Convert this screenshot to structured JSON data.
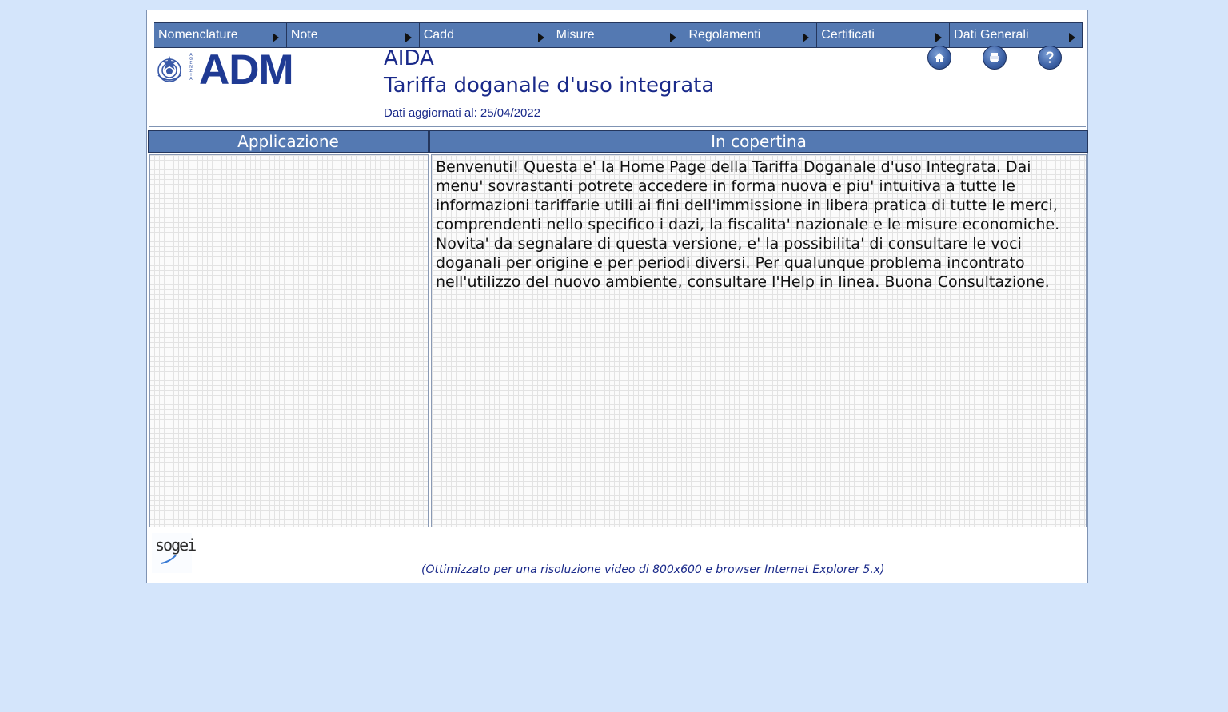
{
  "menu": {
    "items": [
      {
        "label": "Nomenclature"
      },
      {
        "label": "Note"
      },
      {
        "label": "Cadd"
      },
      {
        "label": "Misure"
      },
      {
        "label": "Regolamenti"
      },
      {
        "label": "Certificati"
      },
      {
        "label": "Dati Generali"
      }
    ]
  },
  "header": {
    "logo_text": "ADM",
    "logo_small_text": "AGENZIA",
    "app_name": "AIDA",
    "app_title": "Tariffa doganale d'uso integrata",
    "update_label": "Dati aggiornati al: 25/04/2022",
    "icons": [
      "home-icon",
      "print-icon",
      "help-icon"
    ]
  },
  "sections": {
    "left_title": "Applicazione",
    "right_title": "In copertina"
  },
  "content": {
    "welcome": "Benvenuti! Questa e' la Home Page della Tariffa Doganale d'uso Integrata. Dai menu' sovrastanti potrete accedere in forma nuova e piu' intuitiva a tutte le informazioni tariffarie utili ai fini dell'immissione in libera pratica di tutte le merci, comprendenti nello specifico i dazi, la fiscalita' nazionale e le misure economiche. Novita' da segnalare di questa versione, e' la possibilita' di consultare le voci doganali per origine e per periodi diversi. Per qualunque problema incontrato nell'utilizzo del nuovo ambiente, consultare l'Help in linea. Buona Consultazione."
  },
  "footer": {
    "sogei_logo": "sogei",
    "note": "(Ottimizzato per una risoluzione video di 800x600 e browser Internet Explorer 5.x)"
  },
  "colors": {
    "page_background": "#d4e5fb",
    "menu_background": "#5479b2",
    "brand_blue": "#1f3a93"
  }
}
